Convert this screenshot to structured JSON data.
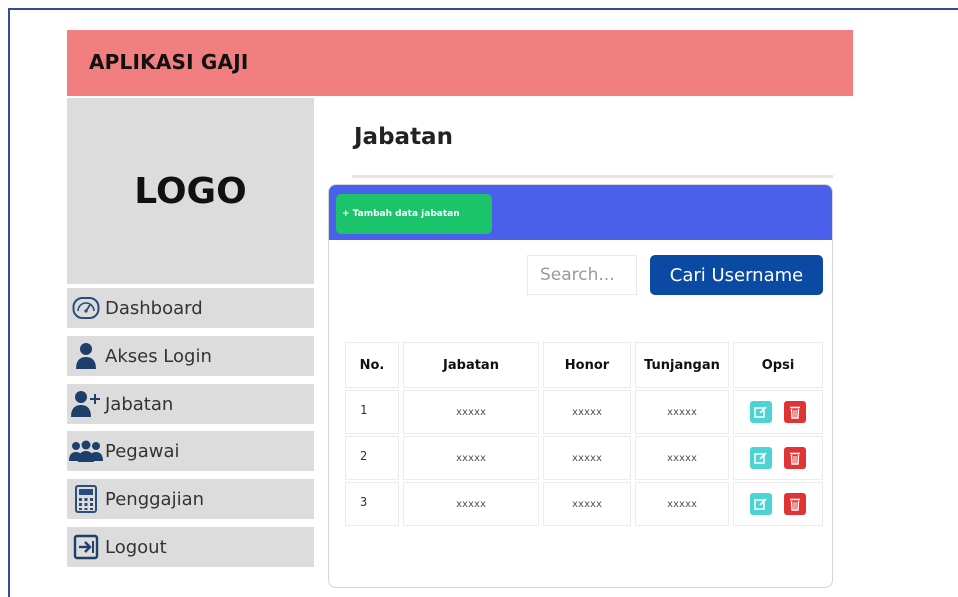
{
  "app": {
    "title": "APLIKASI GAJI",
    "logo": "LOGO"
  },
  "sidebar": {
    "items": [
      {
        "label": "Dashboard",
        "icon": "speedometer-icon"
      },
      {
        "label": "Akses Login",
        "icon": "user-icon"
      },
      {
        "label": "Jabatan",
        "icon": "user-add-icon"
      },
      {
        "label": "Pegawai",
        "icon": "users-group-icon"
      },
      {
        "label": "Penggajian",
        "icon": "calculator-icon"
      },
      {
        "label": "Logout",
        "icon": "logout-icon"
      }
    ]
  },
  "main": {
    "title": "Jabatan",
    "add_button": "+ Tambah data jabatan",
    "search": {
      "placeholder": "Search...",
      "button": "Cari Username"
    },
    "table": {
      "headers": [
        "No.",
        "Jabatan",
        "Honor",
        "Tunjangan",
        "Opsi"
      ],
      "rows": [
        {
          "no": "1",
          "jabatan": "xxxxx",
          "honor": "xxxxx",
          "tunjangan": "xxxxx"
        },
        {
          "no": "2",
          "jabatan": "xxxxx",
          "honor": "xxxxx",
          "tunjangan": "xxxxx"
        },
        {
          "no": "3",
          "jabatan": "xxxxx",
          "honor": "xxxxx",
          "tunjangan": "xxxxx"
        }
      ]
    }
  },
  "colors": {
    "header_bg": "#f17f7f",
    "card_header": "#4a5fea",
    "add_button": "#1bc36a",
    "search_button": "#0a4aa3",
    "edit": "#4dd3d3",
    "delete": "#e03333"
  }
}
